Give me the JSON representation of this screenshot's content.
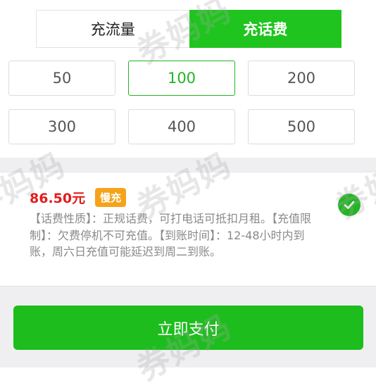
{
  "tabs": [
    {
      "label": "充流量",
      "active": false
    },
    {
      "label": "充话费",
      "active": true
    }
  ],
  "amounts": [
    {
      "value": "50",
      "selected": false
    },
    {
      "value": "100",
      "selected": true
    },
    {
      "value": "200",
      "selected": false
    },
    {
      "value": "300",
      "selected": false
    },
    {
      "value": "400",
      "selected": false
    },
    {
      "value": "500",
      "selected": false
    }
  ],
  "product": {
    "price": "86.50元",
    "badge": "慢充",
    "description": "【话费性质】：正规话费，可打电话可抵扣月租。【充值限制】：欠费停机不可充值。【到账时间】：12-48小时内到账，周六日充值可能延迟到周二到账。",
    "selected": true
  },
  "pay_button": "立即支付",
  "watermark": "券妈妈",
  "colors": {
    "accent": "#20c41f",
    "price": "#e31b1b",
    "badge": "#f5a31a",
    "background_gray": "#efeff2"
  }
}
